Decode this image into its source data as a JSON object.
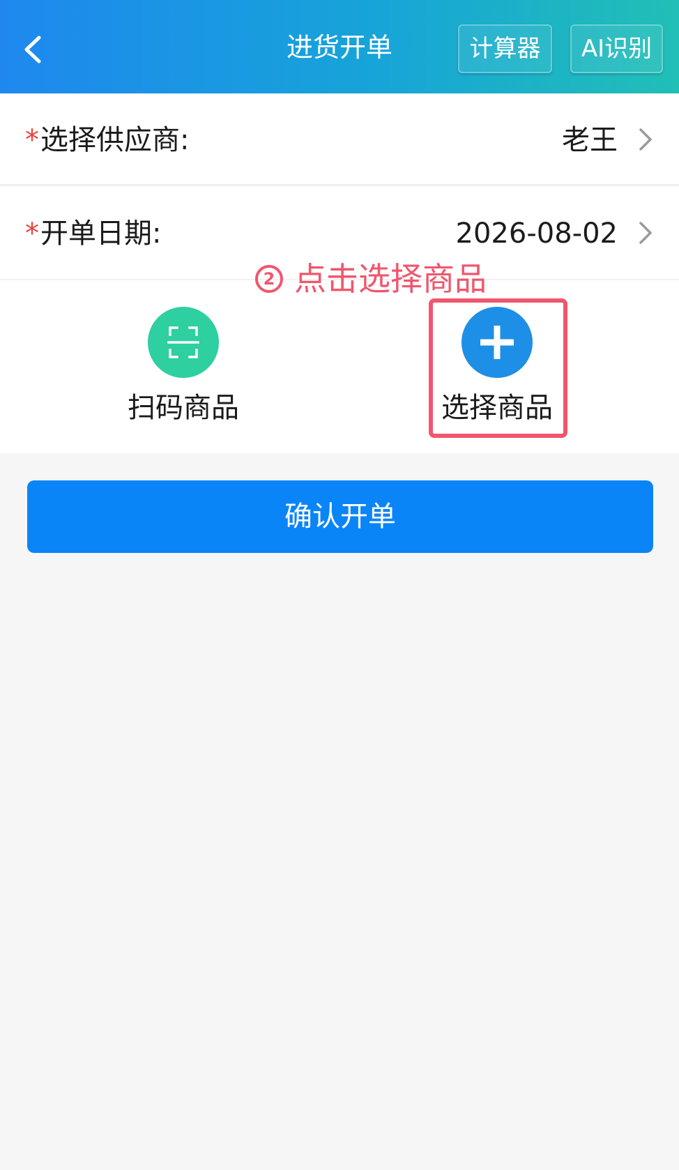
{
  "header": {
    "title": "进货开单",
    "back_icon": "chevron-left-icon",
    "calculator_label": "计算器",
    "ai_label": "AI识别"
  },
  "form": {
    "required_mark": "*",
    "supplier": {
      "label": "选择供应商:",
      "value": "老王"
    },
    "date": {
      "label": "开单日期:",
      "value": "2026-08-02"
    }
  },
  "hint": {
    "number": "2",
    "text": "点击选择商品"
  },
  "actions": {
    "scan": {
      "label": "扫码商品",
      "icon": "scan-icon",
      "color": "#2ecfa0"
    },
    "select": {
      "label": "选择商品",
      "icon": "plus-icon",
      "color": "#1e8fe6"
    }
  },
  "confirm_label": "确认开单",
  "colors": {
    "primary": "#0a85f7",
    "required": "#e8423b",
    "annotation": "#f0566d"
  }
}
